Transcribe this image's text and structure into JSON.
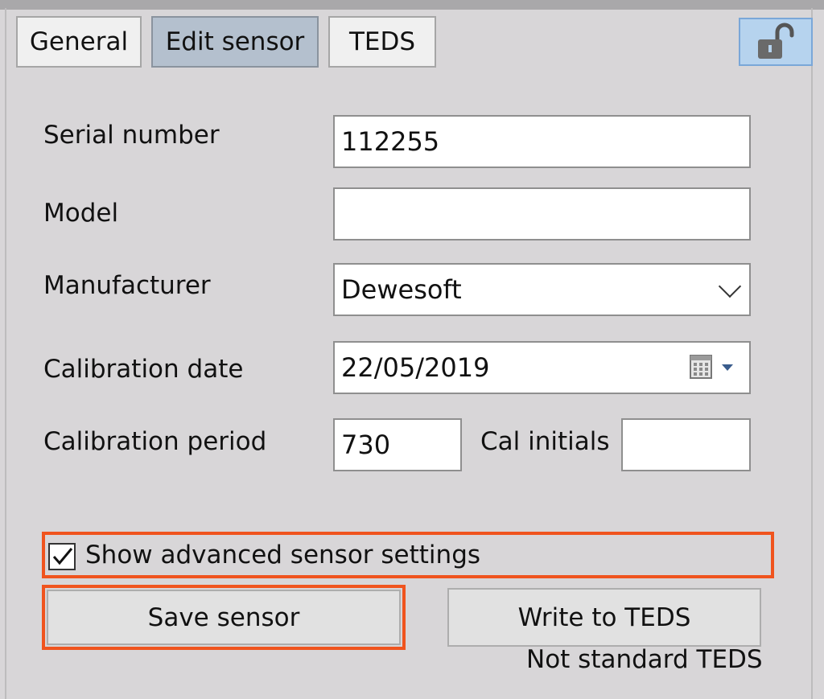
{
  "tabs": [
    {
      "label": "General",
      "active": false
    },
    {
      "label": "Edit sensor",
      "active": true
    },
    {
      "label": "TEDS",
      "active": false
    }
  ],
  "lock": {
    "icon": "unlocked-padlock-icon",
    "state": "unlocked"
  },
  "form": {
    "serial_number": {
      "label": "Serial number",
      "value": "112255"
    },
    "model": {
      "label": "Model",
      "value": ""
    },
    "manufacturer": {
      "label": "Manufacturer",
      "value": "Dewesoft"
    },
    "calibration_date": {
      "label": "Calibration date",
      "value": "22/05/2019"
    },
    "calibration_period": {
      "label": "Calibration period",
      "value": "730"
    },
    "cal_initials": {
      "label": "Cal initials",
      "value": ""
    }
  },
  "advanced": {
    "label": "Show advanced sensor settings",
    "checked": true
  },
  "buttons": {
    "save": "Save sensor",
    "write_teds": "Write to TEDS"
  },
  "teds_status": "Not standard TEDS",
  "colors": {
    "highlight": "#f0541e",
    "active_tab": "#b4c0ce",
    "background": "#d8d6d8"
  }
}
